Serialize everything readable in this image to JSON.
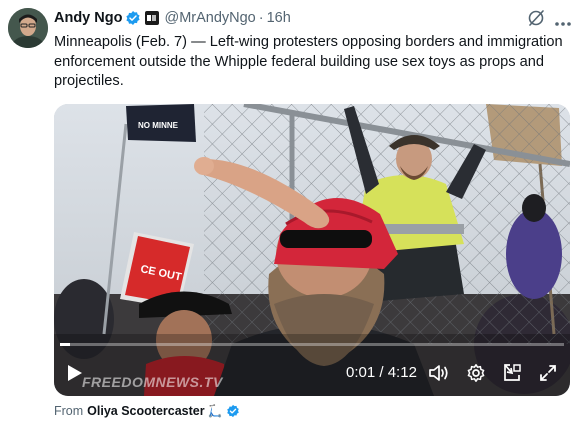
{
  "tweet": {
    "author_name": "Andy Ngo",
    "affiliation_badge": "PM",
    "handle": "@MrAndyNgo",
    "separator": "·",
    "time": "16h",
    "text": "Minneapolis (Feb. 7) — Left-wing protesters opposing borders and immigration enforcement outside the Whipple federal building use sex toys as props and projectiles."
  },
  "video": {
    "banner_text": "NO MINNE",
    "sign_text": "CE OUT",
    "watermark": "FREEDOMNEWS.TV",
    "current_time": "0:01",
    "time_separator": "/",
    "duration": "4:12",
    "progress_fraction": 0.004,
    "controls": [
      "play-icon",
      "volume-icon",
      "settings-gear-icon",
      "picture-in-picture-icon",
      "fullscreen-icon"
    ]
  },
  "source": {
    "prefix": "From",
    "name": "Oliya Scootercaster",
    "emoji": "🛴"
  },
  "colors": {
    "verified_blue": "#1d9bf0",
    "text_primary": "#0f1419",
    "text_secondary": "#536471"
  }
}
